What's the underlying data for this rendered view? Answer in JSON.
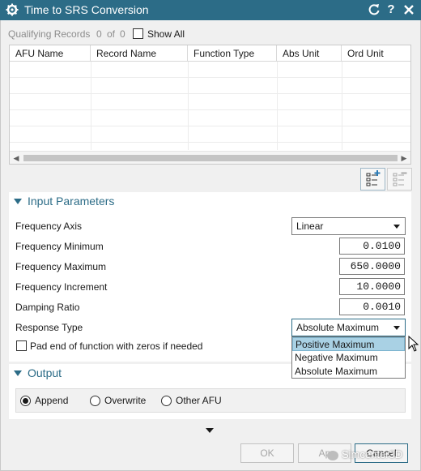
{
  "window": {
    "title": "Time to SRS Conversion"
  },
  "qualifying": {
    "label": "Qualifying Records",
    "count": "0",
    "of_label": "of",
    "total": "0",
    "show_all_label": "Show All"
  },
  "table": {
    "columns": [
      "AFU Name",
      "Record Name",
      "Function Type",
      "Abs Unit",
      "Ord Unit"
    ],
    "rows": []
  },
  "input_parameters": {
    "header": "Input Parameters",
    "frequency_axis": {
      "label": "Frequency Axis",
      "value": "Linear"
    },
    "frequency_minimum": {
      "label": "Frequency Minimum",
      "value": "0.0100"
    },
    "frequency_maximum": {
      "label": "Frequency Maximum",
      "value": "650.0000"
    },
    "frequency_increment": {
      "label": "Frequency Increment",
      "value": "10.0000"
    },
    "damping_ratio": {
      "label": "Damping Ratio",
      "value": "0.0010"
    },
    "response_type": {
      "label": "Response Type",
      "value": "Absolute Maximum",
      "options": [
        "Positive Maximum",
        "Negative Maximum",
        "Absolute Maximum"
      ],
      "highlighted": "Positive Maximum"
    },
    "pad_label": "Pad end of function with zeros if needed"
  },
  "output": {
    "header": "Output",
    "options": [
      "Append",
      "Overwrite",
      "Other AFU"
    ],
    "selected": "Append"
  },
  "buttons": {
    "ok": "OK",
    "apply": "Ap",
    "cancel": "Cancel"
  },
  "watermark": "Simcenter3D",
  "colors": {
    "titlebar": "#2c6c87",
    "accent": "#2c6c87",
    "selection": "#a9d1e4"
  }
}
